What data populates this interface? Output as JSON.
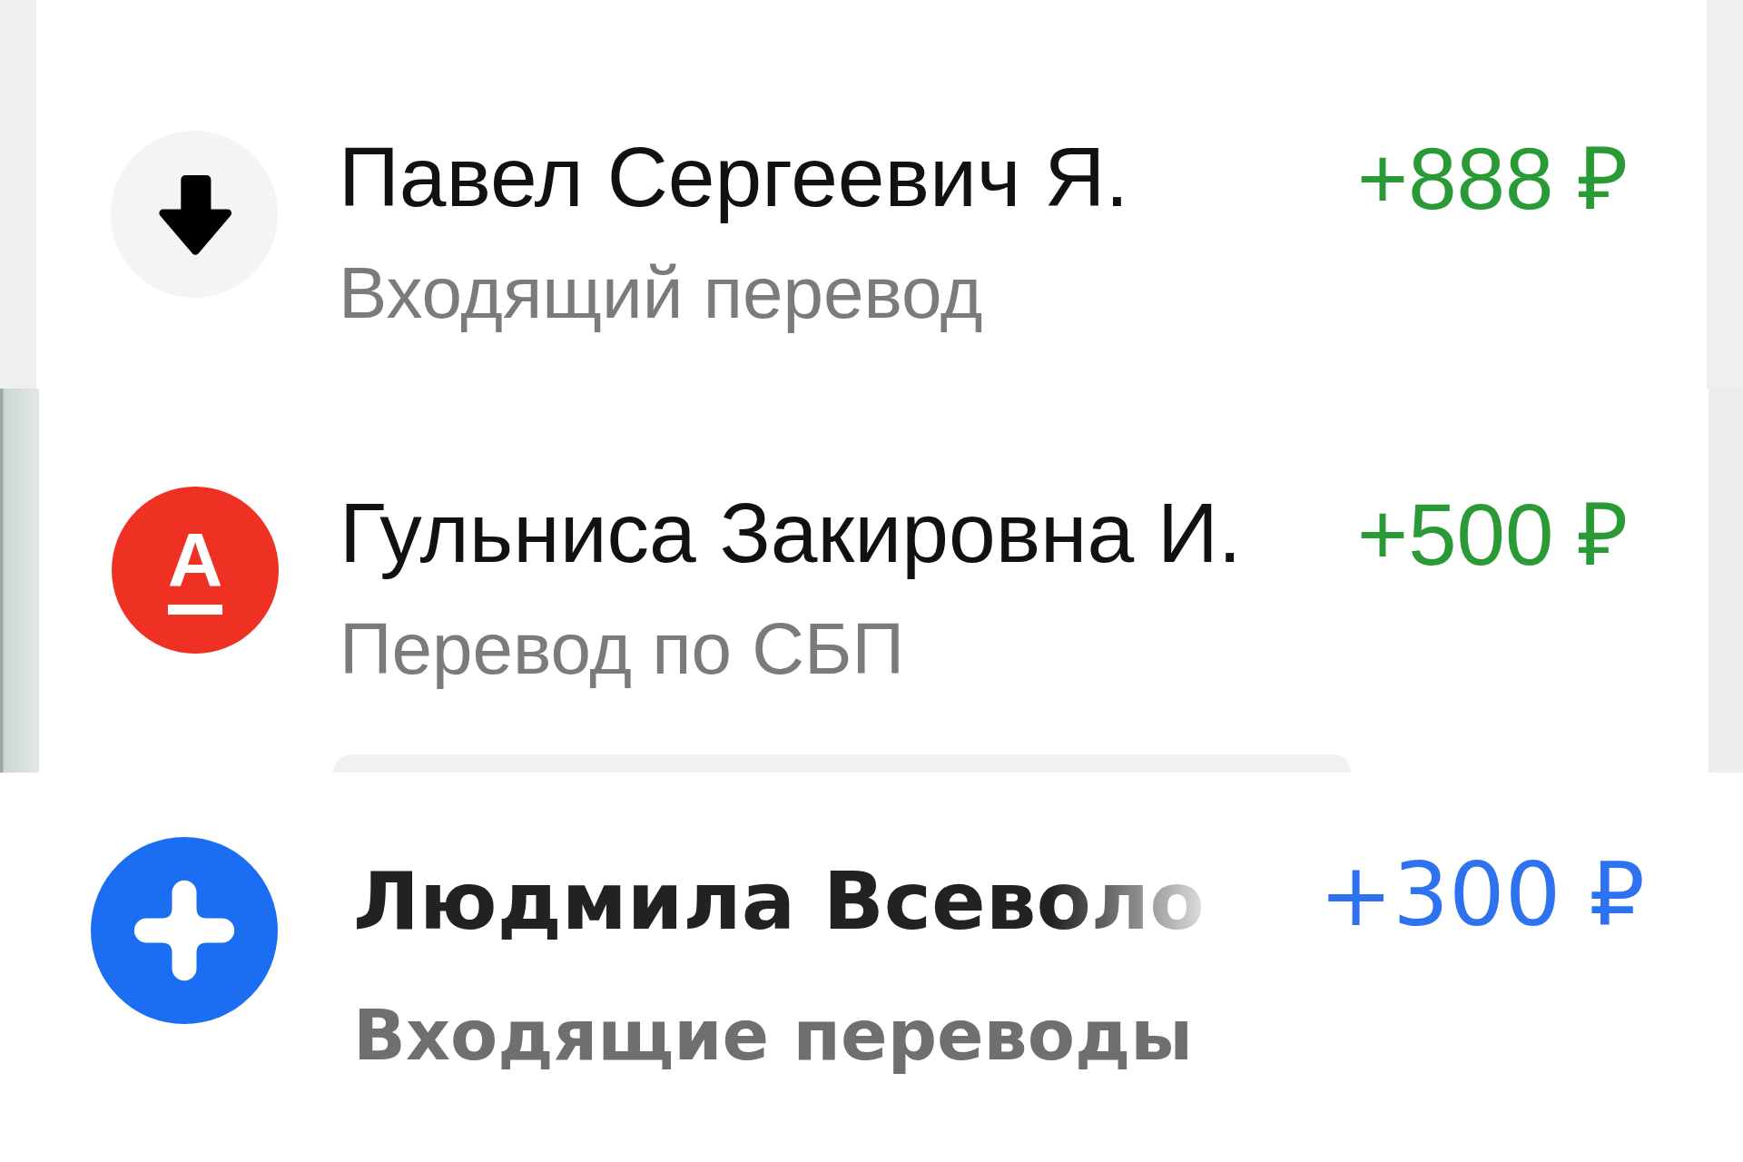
{
  "transactions": [
    {
      "kind": "arrow",
      "name": "Павел Сергеевич Я.",
      "truncated": false,
      "description": "Входящий перевод",
      "amount": "+888 ₽"
    },
    {
      "kind": "letter",
      "icon_letter": "А",
      "name": "Гульниса Закировна И.",
      "truncated": false,
      "description": "Перевод по СБП",
      "amount": "+500 ₽"
    },
    {
      "kind": "plus",
      "name": "Людмила Всеволо",
      "truncated": true,
      "description": "Входящие переводы",
      "amount": "+300 ₽"
    }
  ]
}
